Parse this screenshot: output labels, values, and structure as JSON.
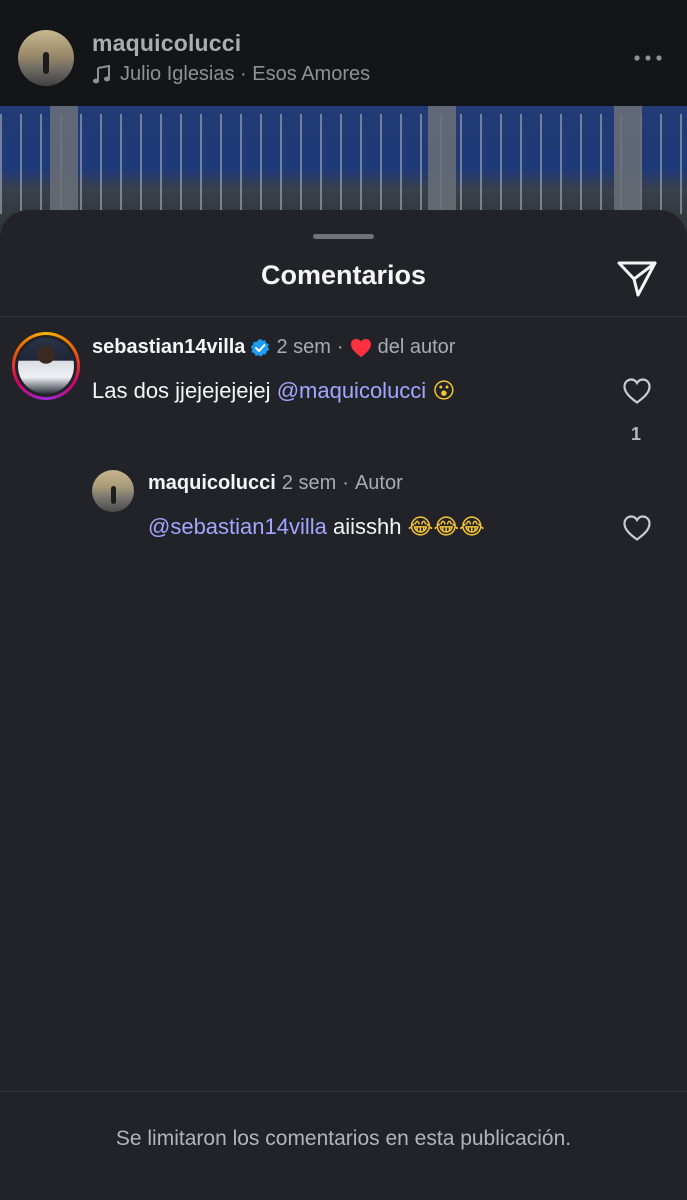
{
  "post": {
    "username": "maquicolucci",
    "music": "Julio Iglesias · Esos Amores",
    "icons": {
      "music": "music-note-icon",
      "more": "more-options-icon"
    }
  },
  "sheet": {
    "title": "Comentarios",
    "share_icon": "paper-plane-icon",
    "footer_text": "Se limitaron los comentarios en esta publicación."
  },
  "comments": [
    {
      "username": "sebastian14villa",
      "verified": true,
      "time": "2 sem",
      "separator": "·",
      "author_like_label": "del autor",
      "text": "Las dos jjejejejejej",
      "mention": "@maquicolucci",
      "emoji": "😮",
      "likes": "1",
      "accent_color": "#ff3040"
    },
    {
      "username": "maquicolucci",
      "time": "2 sem",
      "separator": "·",
      "author_tag": "Autor",
      "mention": "@sebastian14villa",
      "text": "aiisshh",
      "emoji": "😂😂😂"
    }
  ],
  "colors": {
    "sheet_background": "#222328",
    "mention": "#a3a6ff",
    "verified": "#1d9bf0",
    "liked_heart": "#ff3040"
  }
}
